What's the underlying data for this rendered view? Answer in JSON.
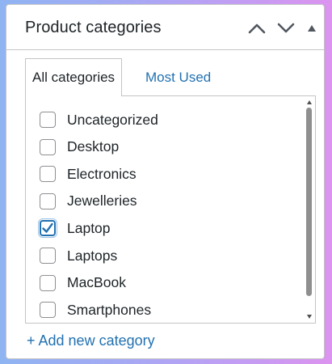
{
  "box": {
    "title": "Product categories",
    "controls": [
      {
        "name": "move-up",
        "icon": "chevron-up-icon"
      },
      {
        "name": "move-down",
        "icon": "chevron-down-icon"
      },
      {
        "name": "toggle-panel",
        "icon": "triangle-up-icon"
      }
    ]
  },
  "tabs": [
    {
      "label": "All categories",
      "active": true
    },
    {
      "label": "Most Used",
      "active": false
    }
  ],
  "categories": [
    {
      "label": "Uncategorized",
      "checked": false
    },
    {
      "label": "Desktop",
      "checked": false
    },
    {
      "label": "Electronics",
      "checked": false
    },
    {
      "label": "Jewelleries",
      "checked": false
    },
    {
      "label": "Laptop",
      "checked": true
    },
    {
      "label": "Laptops",
      "checked": false
    },
    {
      "label": "MacBook",
      "checked": false
    },
    {
      "label": "Smartphones",
      "checked": false
    }
  ],
  "add_link": "+ Add new category",
  "colors": {
    "accent": "#2271b1",
    "text": "#1d2327",
    "border": "#c3c4c7"
  }
}
